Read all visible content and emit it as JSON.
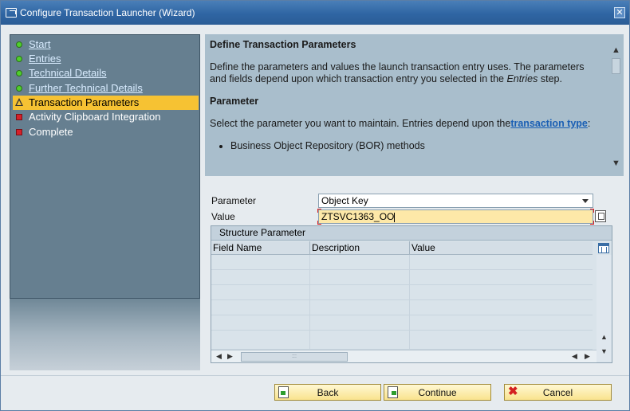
{
  "window": {
    "title": "Configure Transaction Launcher (Wizard)",
    "close_glyph": "✕"
  },
  "steps": [
    {
      "label": "Start",
      "state": "done"
    },
    {
      "label": "Entries",
      "state": "done"
    },
    {
      "label": "Technical Details",
      "state": "done"
    },
    {
      "label": "Further Technical Details",
      "state": "done"
    },
    {
      "label": "Transaction Parameters",
      "state": "active"
    },
    {
      "label": "Activity Clipboard Integration",
      "state": "pending"
    },
    {
      "label": "Complete",
      "state": "pending"
    }
  ],
  "help": {
    "heading": "Define Transaction Parameters",
    "p1_a": "Define the parameters and values the launch transaction entry uses. The parameters and fields depend upon which transaction entry you selected in the ",
    "p1_em": "Entries",
    "p1_b": " step.",
    "sub_heading": "Parameter",
    "p2_a": "Select the parameter you want to maintain. Entries depend upon the",
    "p2_link": "transaction type",
    "p2_b": ":",
    "bullet1": "Business Object Repository (BOR) methods"
  },
  "form": {
    "parameter_label": "Parameter",
    "parameter_value": "Object Key",
    "value_label": "Value",
    "value_value": "ZTSVC1363_OO"
  },
  "table": {
    "title": "Structure Parameter",
    "columns": [
      "Field Name",
      "Description",
      "Value"
    ],
    "hscroll_grip": ":::"
  },
  "buttons": {
    "back": "Back",
    "continue": "Continue",
    "cancel": "Cancel"
  },
  "icons": {
    "window": "transaction-icon",
    "step_done": "green-dot-icon",
    "step_active": "warning-triangle-icon",
    "step_pending": "red-square-icon"
  },
  "colors": {
    "accent": "#f6c233",
    "title_bar": "#2f65a3",
    "link": "#1a5fb4",
    "steps_panel": "#667f90",
    "help_panel": "#a9becc"
  }
}
